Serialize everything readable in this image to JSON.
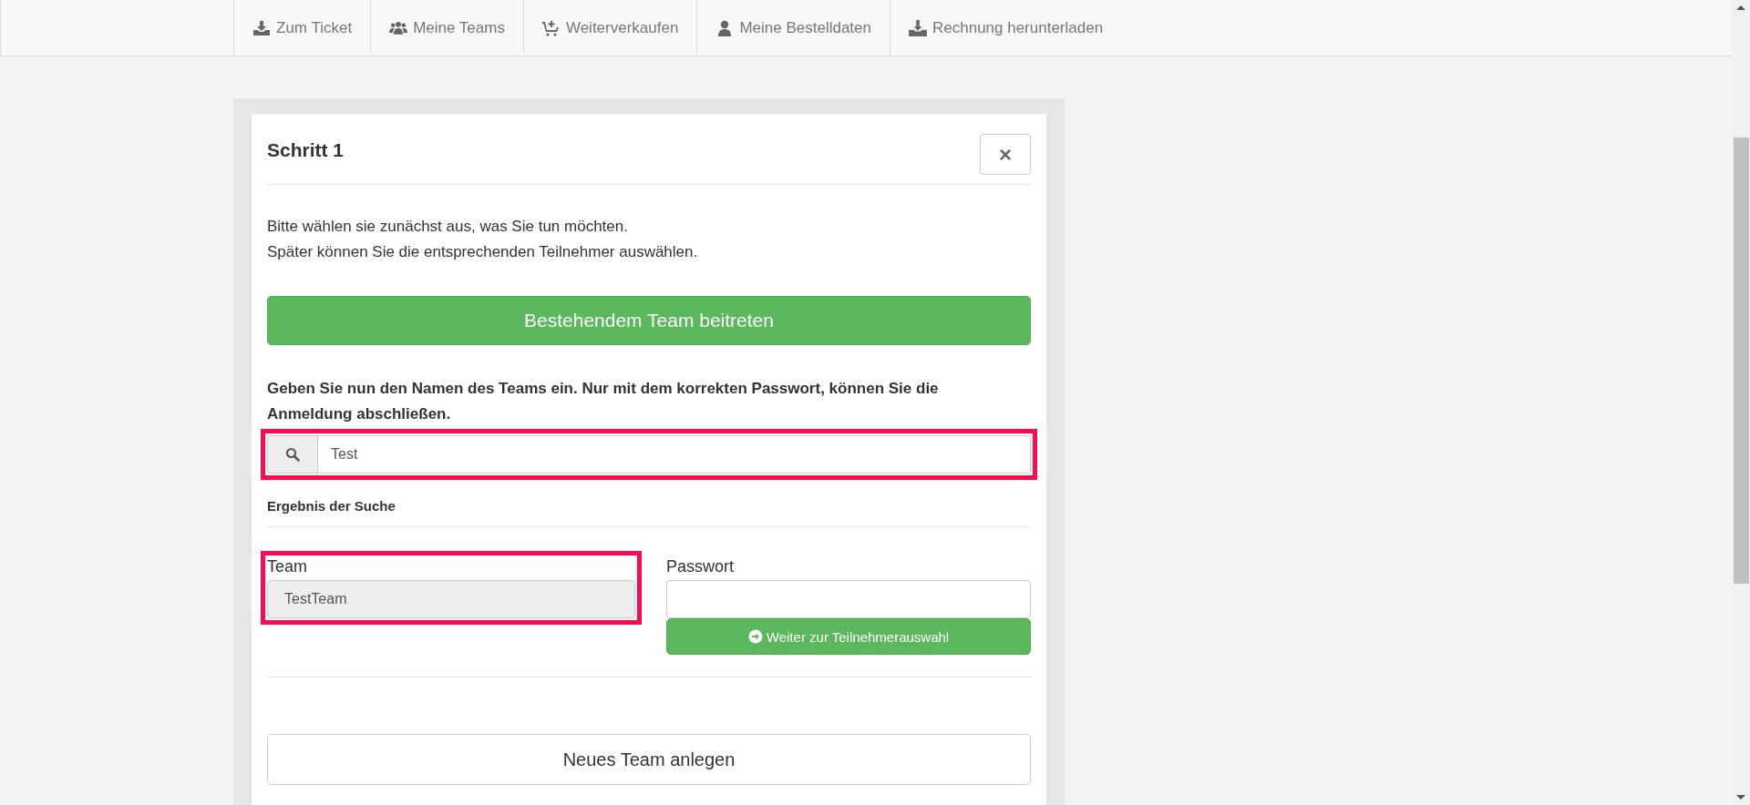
{
  "nav": [
    {
      "label": "Zum Ticket"
    },
    {
      "label": "Meine Teams"
    },
    {
      "label": "Weiterverkaufen"
    },
    {
      "label": "Meine Bestelldaten"
    },
    {
      "label": "Rechnung herunterladen"
    }
  ],
  "dialog": {
    "title": "Schritt 1",
    "close": "×",
    "intro": [
      "Bitte wählen sie zunächst aus, was Sie tun möchten.",
      "Später können Sie die entsprechenden Teilnehmer auswählen."
    ],
    "join_button": "Bestehendem Team beitreten",
    "instruction": "Geben Sie nun den Namen des Teams ein. Nur mit dem korrekten Passwort, können Sie die Anmeldung abschließen.",
    "search": {
      "value": "Test",
      "highlighted": true
    },
    "result_heading": "Ergebnis der Suche",
    "team": {
      "label": "Team",
      "value": "TestTeam",
      "disabled": true,
      "highlighted": true
    },
    "password": {
      "label": "Passwort"
    },
    "continue_button": "Weiter zur Teilnehmerauswahl",
    "new_team_button": "Neues Team anlegen"
  }
}
